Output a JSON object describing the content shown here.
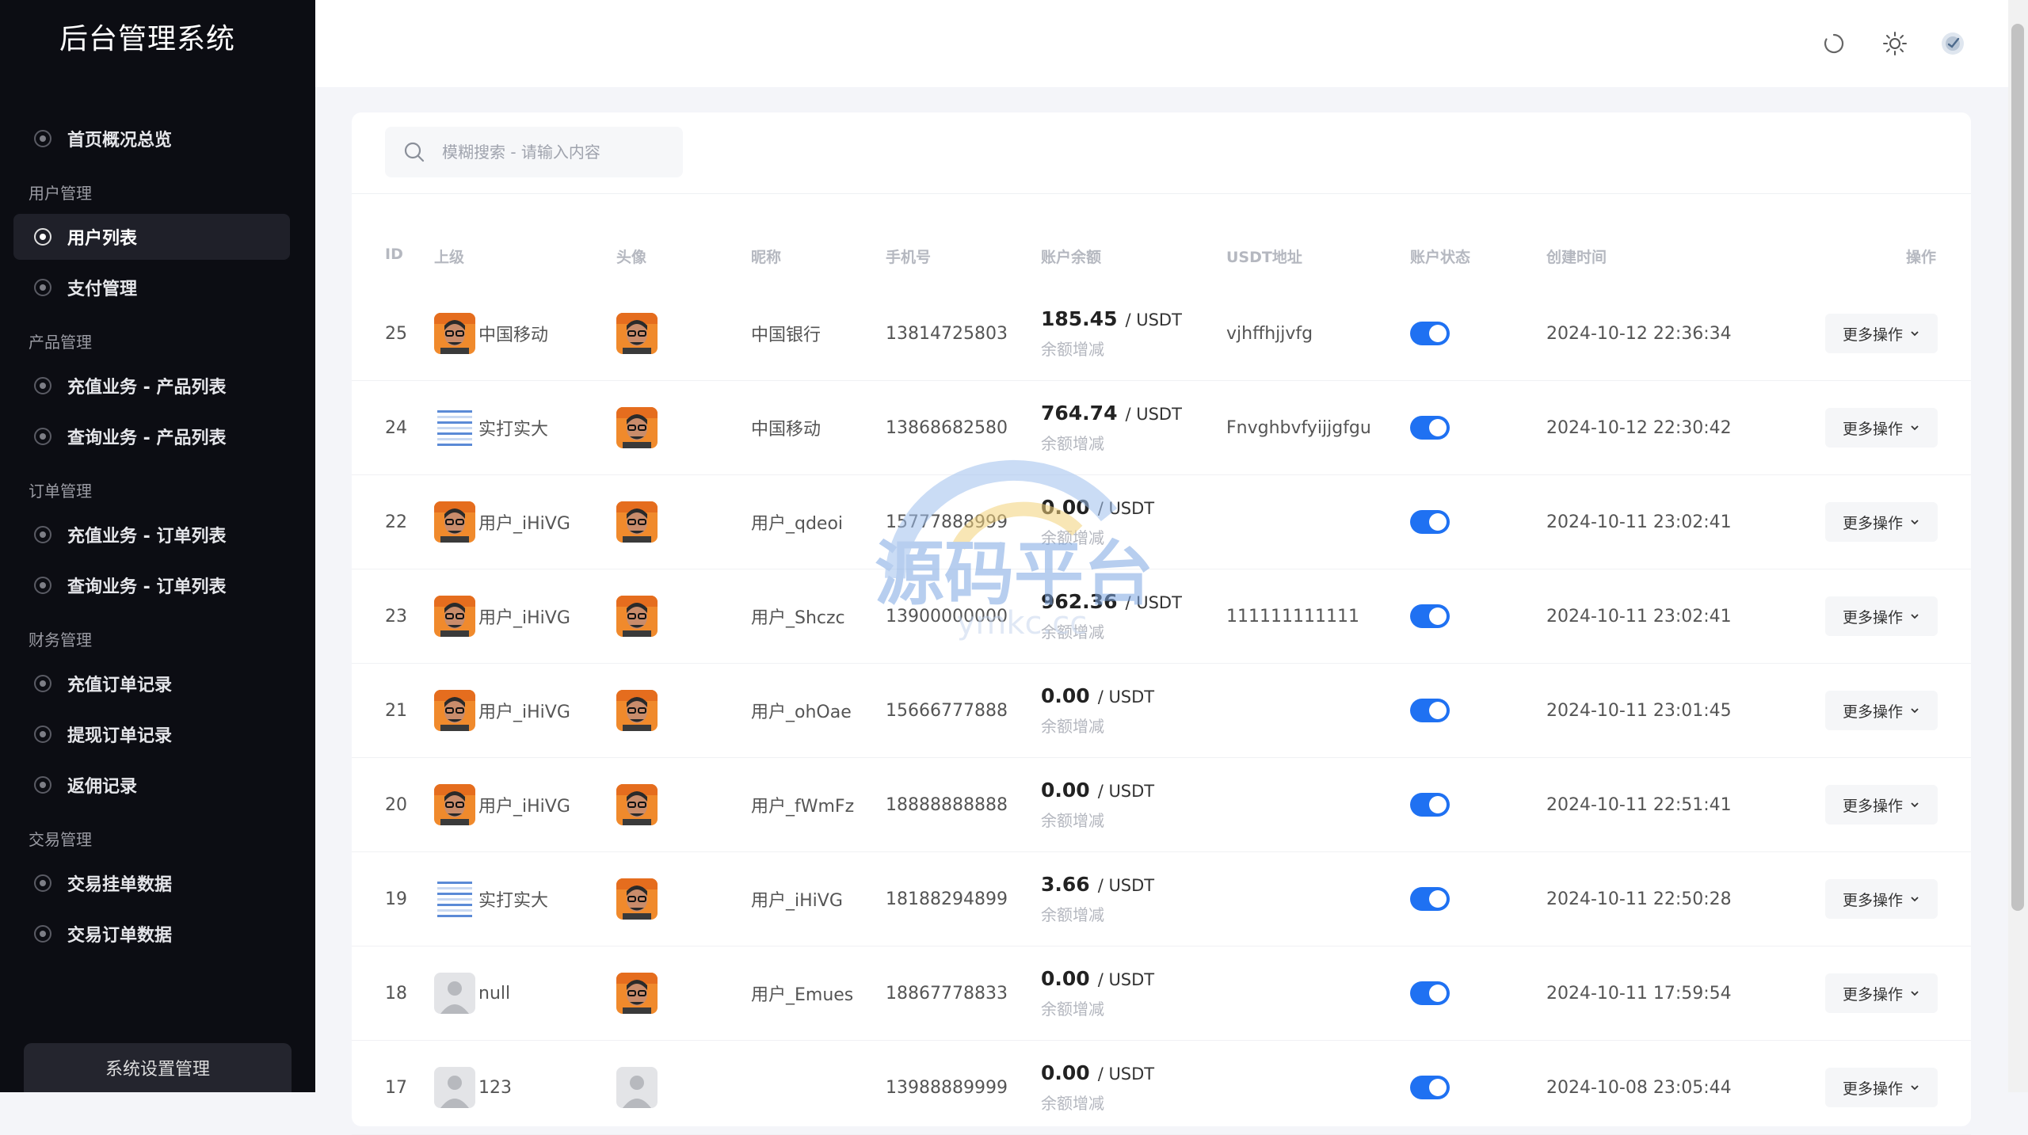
{
  "app_title": "后台管理系统",
  "sidebar": {
    "sections": [
      {
        "title": "",
        "items": [
          {
            "label": "首页概况总览",
            "active": false
          }
        ]
      },
      {
        "title": "用户管理",
        "items": [
          {
            "label": "用户列表",
            "active": true
          },
          {
            "label": "支付管理",
            "active": false
          }
        ]
      },
      {
        "title": "产品管理",
        "items": [
          {
            "label": "充值业务 - 产品列表",
            "active": false
          },
          {
            "label": "查询业务 - 产品列表",
            "active": false
          }
        ]
      },
      {
        "title": "订单管理",
        "items": [
          {
            "label": "充值业务 - 订单列表",
            "active": false
          },
          {
            "label": "查询业务 - 订单列表",
            "active": false
          }
        ]
      },
      {
        "title": "财务管理",
        "items": [
          {
            "label": "充值订单记录",
            "active": false
          },
          {
            "label": "提现订单记录",
            "active": false
          },
          {
            "label": "返佣记录",
            "active": false
          }
        ]
      },
      {
        "title": "交易管理",
        "items": [
          {
            "label": "交易挂单数据",
            "active": false
          },
          {
            "label": "交易订单数据",
            "active": false
          }
        ]
      }
    ],
    "footer_button": "系统设置管理"
  },
  "header": {
    "icons": [
      "refresh-icon",
      "sun-icon",
      "user-avatar-icon"
    ]
  },
  "search": {
    "placeholder": "模糊搜索 - 请输入内容"
  },
  "table": {
    "columns": [
      "ID",
      "上级",
      "头像",
      "昵称",
      "手机号",
      "账户余额",
      "USDT地址",
      "账户状态",
      "创建时间",
      "操作"
    ],
    "balance_sub": "余额增减",
    "unit": "/ USDT",
    "action_label": "更多操作",
    "rows": [
      {
        "id": "25",
        "parent": "中国移动",
        "parent_avatar": "photo",
        "avatar": "photo",
        "nickname": "中国银行",
        "phone": "13814725803",
        "balance": "185.45",
        "usdt": "vjhffhjjvfg",
        "status": true,
        "created": "2024-10-12 22:36:34"
      },
      {
        "id": "24",
        "parent": "实打实大",
        "parent_avatar": "doc",
        "avatar": "photo",
        "nickname": "中国移动",
        "phone": "13868682580",
        "balance": "764.74",
        "usdt": "Fnvghbvfyijjgfgu",
        "status": true,
        "created": "2024-10-12 22:30:42"
      },
      {
        "id": "22",
        "parent": "用户_iHiVG",
        "parent_avatar": "photo",
        "avatar": "photo",
        "nickname": "用户_qdeoi",
        "phone": "15777888999",
        "balance": "0.00",
        "usdt": "",
        "status": true,
        "created": "2024-10-11 23:02:41"
      },
      {
        "id": "23",
        "parent": "用户_iHiVG",
        "parent_avatar": "photo",
        "avatar": "photo",
        "nickname": "用户_Shczc",
        "phone": "13900000000",
        "balance": "962.36",
        "usdt": "111111111111",
        "status": true,
        "created": "2024-10-11 23:02:41"
      },
      {
        "id": "21",
        "parent": "用户_iHiVG",
        "parent_avatar": "photo",
        "avatar": "photo",
        "nickname": "用户_ohOae",
        "phone": "15666777888",
        "balance": "0.00",
        "usdt": "",
        "status": true,
        "created": "2024-10-11 23:01:45"
      },
      {
        "id": "20",
        "parent": "用户_iHiVG",
        "parent_avatar": "photo",
        "avatar": "photo",
        "nickname": "用户_fWmFz",
        "phone": "18888888888",
        "balance": "0.00",
        "usdt": "",
        "status": true,
        "created": "2024-10-11 22:51:41"
      },
      {
        "id": "19",
        "parent": "实打实大",
        "parent_avatar": "doc",
        "avatar": "photo",
        "nickname": "用户_iHiVG",
        "phone": "18188294899",
        "balance": "3.66",
        "usdt": "",
        "status": true,
        "created": "2024-10-11 22:50:28"
      },
      {
        "id": "18",
        "parent": "null",
        "parent_avatar": "default",
        "avatar": "photo",
        "nickname": "用户_Emues",
        "phone": "18867778833",
        "balance": "0.00",
        "usdt": "",
        "status": true,
        "created": "2024-10-11 17:59:54"
      },
      {
        "id": "17",
        "parent": "123",
        "parent_avatar": "default",
        "avatar": "default",
        "nickname": "",
        "phone": "13988889999",
        "balance": "0.00",
        "usdt": "",
        "status": true,
        "created": "2024-10-08 23:05:44"
      }
    ]
  },
  "watermark": {
    "text": "源码平台",
    "sub": "ymkc.cc"
  },
  "colors": {
    "sidebar_bg": "#0c0d13",
    "accent": "#1f71f2",
    "page_bg": "#f4f5f9"
  }
}
